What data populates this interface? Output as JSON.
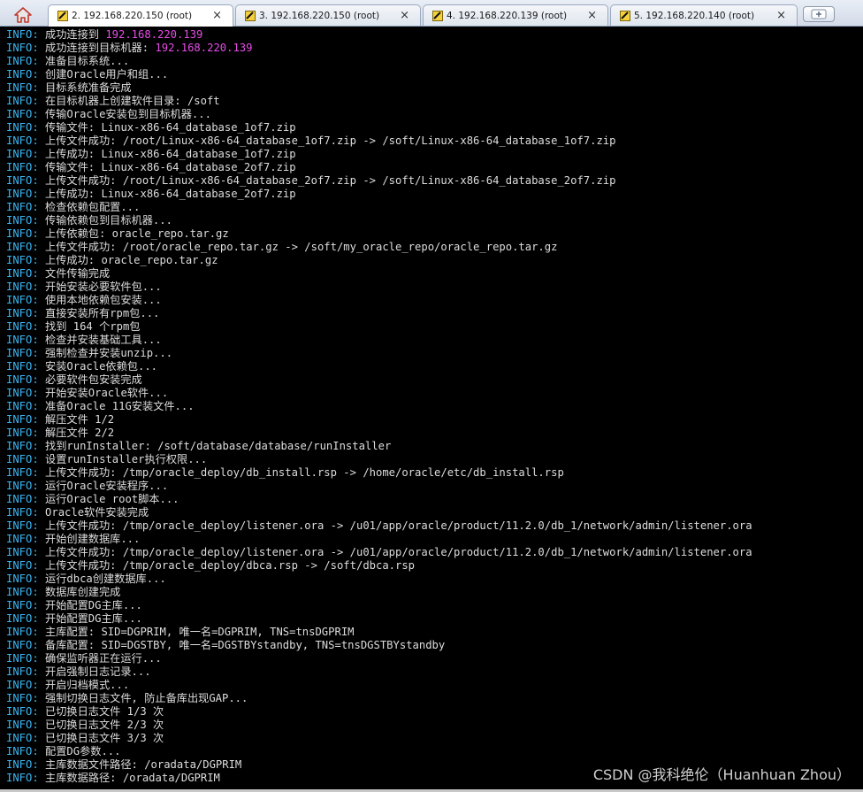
{
  "tabs": [
    {
      "label": "2. 192.168.220.150 (root)",
      "active": true,
      "close_label": "×"
    },
    {
      "label": "3. 192.168.220.150 (root)",
      "active": false,
      "close_label": "×"
    },
    {
      "label": "4. 192.168.220.139 (root)",
      "active": false,
      "close_label": "×"
    },
    {
      "label": "5. 192.168.220.140 (root)",
      "active": false,
      "close_label": "×"
    }
  ],
  "colors": {
    "level": "#3bb5f0",
    "highlight": "#e64ce6",
    "text": "#dddddd",
    "background": "#000000"
  },
  "terminal": {
    "lines": [
      {
        "level": "INFO:",
        "text": "成功连接到 ",
        "hl": "192.168.220.139"
      },
      {
        "level": "INFO:",
        "text": "成功连接到目标机器: ",
        "hl": "192.168.220.139"
      },
      {
        "level": "INFO:",
        "text": "准备目标系统..."
      },
      {
        "level": "INFO:",
        "text": "创建Oracle用户和组..."
      },
      {
        "level": "INFO:",
        "text": "目标系统准备完成"
      },
      {
        "level": "INFO:",
        "text": "在目标机器上创建软件目录: /soft"
      },
      {
        "level": "INFO:",
        "text": "传输Oracle安装包到目标机器..."
      },
      {
        "level": "INFO:",
        "text": "传输文件: Linux-x86-64_database_1of7.zip"
      },
      {
        "level": "INFO:",
        "text": "上传文件成功: /root/Linux-x86-64_database_1of7.zip -> /soft/Linux-x86-64_database_1of7.zip"
      },
      {
        "level": "INFO:",
        "text": "上传成功: Linux-x86-64_database_1of7.zip"
      },
      {
        "level": "INFO:",
        "text": "传输文件: Linux-x86-64_database_2of7.zip"
      },
      {
        "level": "INFO:",
        "text": "上传文件成功: /root/Linux-x86-64_database_2of7.zip -> /soft/Linux-x86-64_database_2of7.zip"
      },
      {
        "level": "INFO:",
        "text": "上传成功: Linux-x86-64_database_2of7.zip"
      },
      {
        "level": "INFO:",
        "text": "检查依赖包配置..."
      },
      {
        "level": "INFO:",
        "text": "传输依赖包到目标机器..."
      },
      {
        "level": "INFO:",
        "text": "上传依赖包: oracle_repo.tar.gz"
      },
      {
        "level": "INFO:",
        "text": "上传文件成功: /root/oracle_repo.tar.gz -> /soft/my_oracle_repo/oracle_repo.tar.gz"
      },
      {
        "level": "INFO:",
        "text": "上传成功: oracle_repo.tar.gz"
      },
      {
        "level": "INFO:",
        "text": "文件传输完成"
      },
      {
        "level": "INFO:",
        "text": "开始安装必要软件包..."
      },
      {
        "level": "INFO:",
        "text": "使用本地依赖包安装..."
      },
      {
        "level": "INFO:",
        "text": "直接安装所有rpm包..."
      },
      {
        "level": "INFO:",
        "text": "找到 164 个rpm包"
      },
      {
        "level": "INFO:",
        "text": "检查并安装基础工具..."
      },
      {
        "level": "INFO:",
        "text": "强制检查并安装unzip..."
      },
      {
        "level": "INFO:",
        "text": "安装Oracle依赖包..."
      },
      {
        "level": "INFO:",
        "text": "必要软件包安装完成"
      },
      {
        "level": "INFO:",
        "text": "开始安装Oracle软件..."
      },
      {
        "level": "INFO:",
        "text": "准备Oracle 11G安装文件..."
      },
      {
        "level": "INFO:",
        "text": "解压文件 1/2"
      },
      {
        "level": "INFO:",
        "text": "解压文件 2/2"
      },
      {
        "level": "INFO:",
        "text": "找到runInstaller: /soft/database/database/runInstaller"
      },
      {
        "level": "INFO:",
        "text": "设置runInstaller执行权限..."
      },
      {
        "level": "INFO:",
        "text": "上传文件成功: /tmp/oracle_deploy/db_install.rsp -> /home/oracle/etc/db_install.rsp"
      },
      {
        "level": "INFO:",
        "text": "运行Oracle安装程序..."
      },
      {
        "level": "INFO:",
        "text": "运行Oracle root脚本..."
      },
      {
        "level": "INFO:",
        "text": "Oracle软件安装完成"
      },
      {
        "level": "INFO:",
        "text": "上传文件成功: /tmp/oracle_deploy/listener.ora -> /u01/app/oracle/product/11.2.0/db_1/network/admin/listener.ora"
      },
      {
        "level": "INFO:",
        "text": "开始创建数据库..."
      },
      {
        "level": "INFO:",
        "text": "上传文件成功: /tmp/oracle_deploy/listener.ora -> /u01/app/oracle/product/11.2.0/db_1/network/admin/listener.ora"
      },
      {
        "level": "INFO:",
        "text": "上传文件成功: /tmp/oracle_deploy/dbca.rsp -> /soft/dbca.rsp"
      },
      {
        "level": "INFO:",
        "text": "运行dbca创建数据库..."
      },
      {
        "level": "INFO:",
        "text": "数据库创建完成"
      },
      {
        "level": "INFO:",
        "text": "开始配置DG主库..."
      },
      {
        "level": "INFO:",
        "text": "开始配置DG主库..."
      },
      {
        "level": "INFO:",
        "text": "主库配置: SID=DGPRIM, 唯一名=DGPRIM, TNS=tnsDGPRIM"
      },
      {
        "level": "INFO:",
        "text": "备库配置: SID=DGSTBY, 唯一名=DGSTBYstandby, TNS=tnsDGSTBYstandby"
      },
      {
        "level": "INFO:",
        "text": "确保监听器正在运行..."
      },
      {
        "level": "INFO:",
        "text": "开启强制日志记录..."
      },
      {
        "level": "INFO:",
        "text": "开启归档模式..."
      },
      {
        "level": "INFO:",
        "text": "强制切换日志文件, 防止备库出现GAP..."
      },
      {
        "level": "INFO:",
        "text": "已切换日志文件 1/3 次"
      },
      {
        "level": "INFO:",
        "text": "已切换日志文件 2/3 次"
      },
      {
        "level": "INFO:",
        "text": "已切换日志文件 3/3 次"
      },
      {
        "level": "INFO:",
        "text": "配置DG参数..."
      },
      {
        "level": "INFO:",
        "text": "主库数据文件路径: /oradata/DGPRIM"
      },
      {
        "level": "INFO:",
        "text": "主库数据路径: /oradata/DGPRIM"
      }
    ]
  },
  "watermark": "CSDN @我科绝伦（Huanhuan Zhou）"
}
